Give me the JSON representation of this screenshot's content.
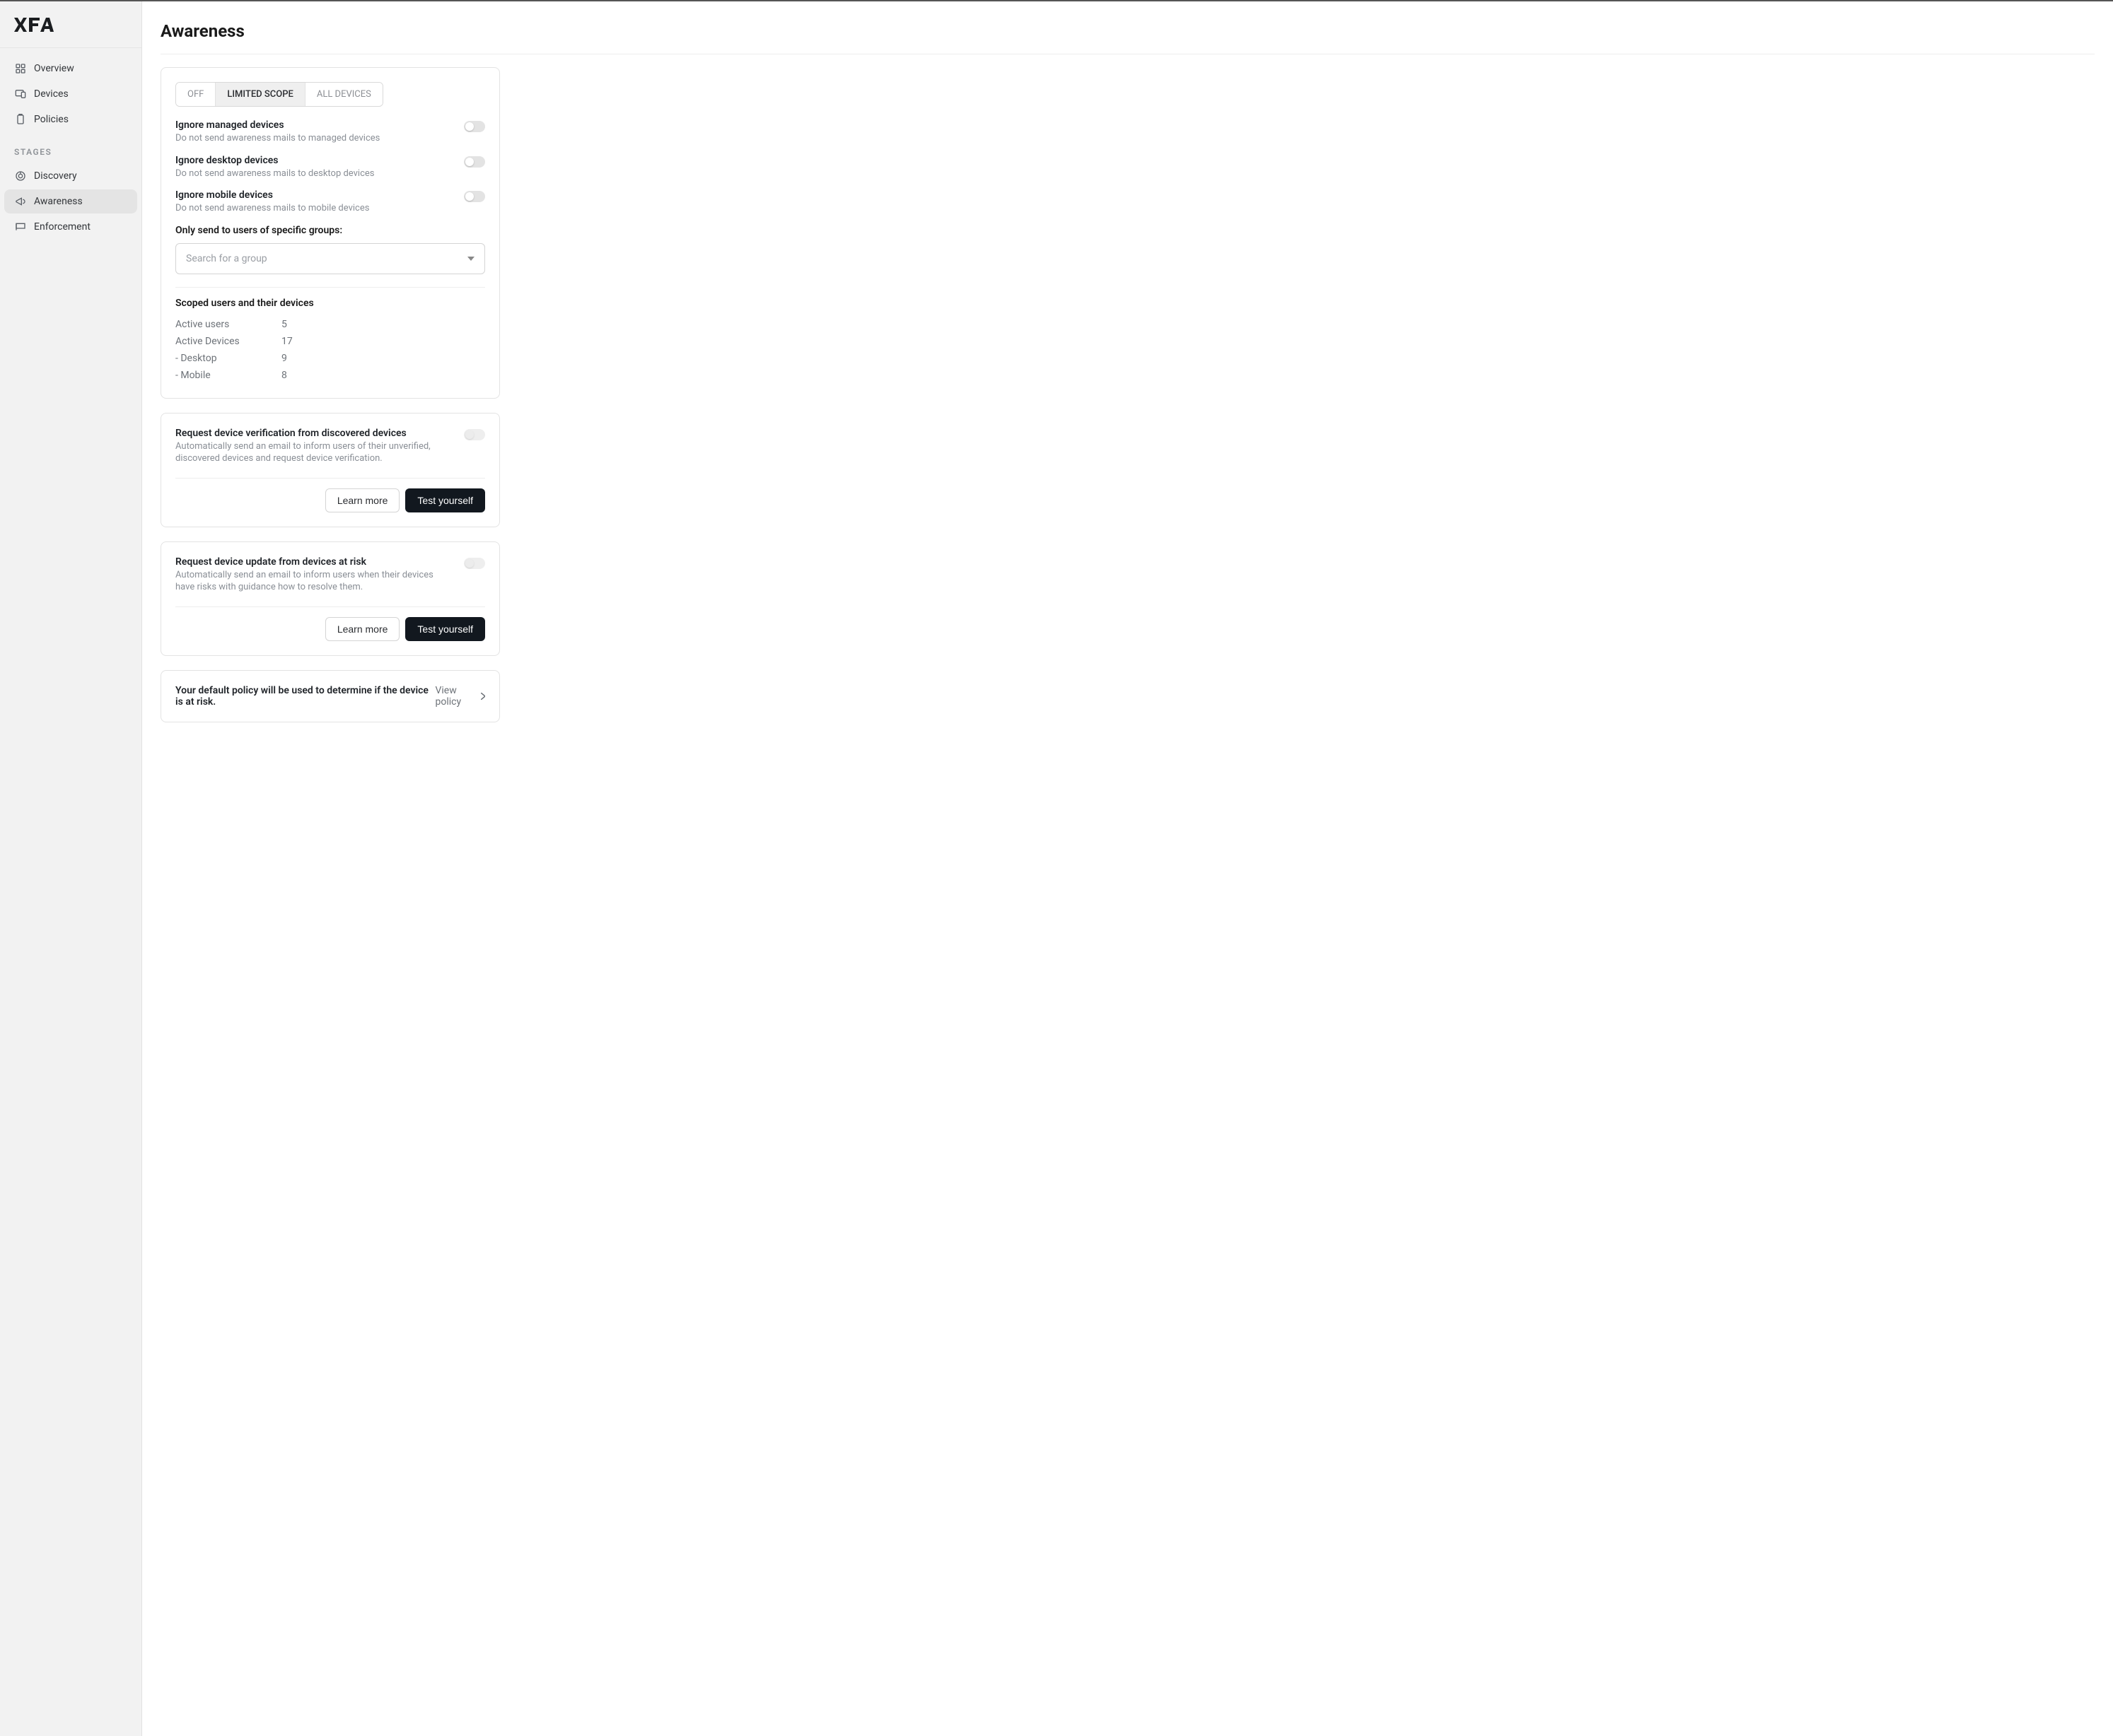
{
  "brand": {
    "name": "XFA"
  },
  "nav": {
    "main": [
      {
        "label": "Overview"
      },
      {
        "label": "Devices"
      },
      {
        "label": "Policies"
      }
    ],
    "stagesTitle": "STAGES",
    "stages": [
      {
        "label": "Discovery"
      },
      {
        "label": "Awareness"
      },
      {
        "label": "Enforcement"
      }
    ]
  },
  "page": {
    "title": "Awareness"
  },
  "scopeTabs": {
    "off": "OFF",
    "limited": "LIMITED SCOPE",
    "all": "ALL DEVICES"
  },
  "settings": {
    "ignoreManaged": {
      "title": "Ignore managed devices",
      "desc": "Do not send awareness mails to managed devices"
    },
    "ignoreDesktop": {
      "title": "Ignore desktop devices",
      "desc": "Do not send awareness mails to desktop devices"
    },
    "ignoreMobile": {
      "title": "Ignore mobile devices",
      "desc": "Do not send awareness mails to mobile devices"
    }
  },
  "groups": {
    "label": "Only send to users of specific groups:",
    "placeholder": "Search for a group"
  },
  "stats": {
    "title": "Scoped users and their devices",
    "rows": [
      {
        "label": "Active users",
        "value": "5"
      },
      {
        "label": "Active Devices",
        "value": "17"
      },
      {
        "label": "- Desktop",
        "value": "9"
      },
      {
        "label": "- Mobile",
        "value": "8"
      }
    ]
  },
  "verification": {
    "title": "Request device verification from discovered devices",
    "desc": "Automatically send an email to inform users of their unverified, discovered devices and request device verification.",
    "learnMore": "Learn more",
    "testYourself": "Test yourself"
  },
  "update": {
    "title": "Request device update from devices at risk",
    "desc": "Automatically send an email to inform users when their devices have risks with guidance how to resolve them.",
    "learnMore": "Learn more",
    "testYourself": "Test yourself"
  },
  "policyNotice": {
    "msg": "Your default policy will be used to determine if the device is at risk.",
    "link": "View policy"
  }
}
